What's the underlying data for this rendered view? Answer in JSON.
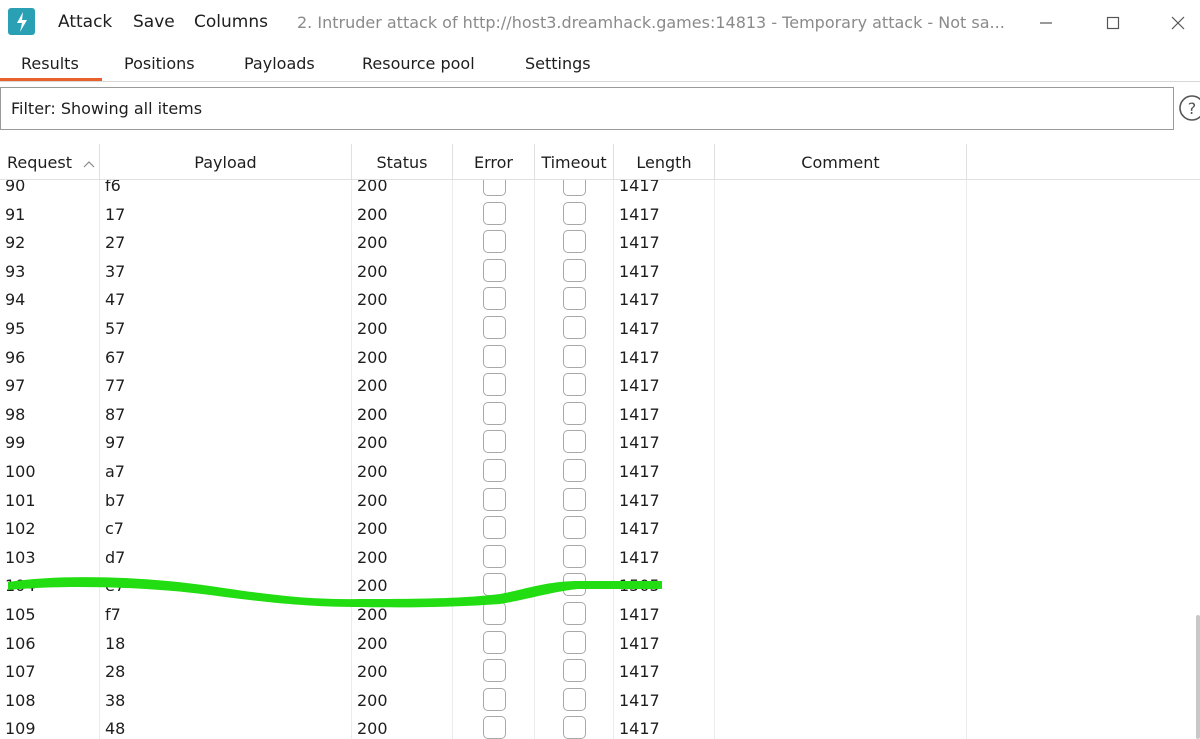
{
  "window": {
    "title": "2. Intruder attack of http://host3.dreamhack.games:14813 - Temporary attack - Not sa..."
  },
  "menu": {
    "attack": "Attack",
    "save": "Save",
    "columns": "Columns"
  },
  "tabs": {
    "results": "Results",
    "positions": "Positions",
    "payloads": "Payloads",
    "resource_pool": "Resource pool",
    "settings": "Settings"
  },
  "filter": {
    "text": "Filter: Showing all items"
  },
  "columns": {
    "request": "Request",
    "payload": "Payload",
    "status": "Status",
    "error": "Error",
    "timeout": "Timeout",
    "length": "Length",
    "comment": "Comment"
  },
  "rows": [
    {
      "request": "90",
      "payload": "f6",
      "status": "200",
      "length": "1417"
    },
    {
      "request": "91",
      "payload": "17",
      "status": "200",
      "length": "1417"
    },
    {
      "request": "92",
      "payload": "27",
      "status": "200",
      "length": "1417"
    },
    {
      "request": "93",
      "payload": "37",
      "status": "200",
      "length": "1417"
    },
    {
      "request": "94",
      "payload": "47",
      "status": "200",
      "length": "1417"
    },
    {
      "request": "95",
      "payload": "57",
      "status": "200",
      "length": "1417"
    },
    {
      "request": "96",
      "payload": "67",
      "status": "200",
      "length": "1417"
    },
    {
      "request": "97",
      "payload": "77",
      "status": "200",
      "length": "1417"
    },
    {
      "request": "98",
      "payload": "87",
      "status": "200",
      "length": "1417"
    },
    {
      "request": "99",
      "payload": "97",
      "status": "200",
      "length": "1417"
    },
    {
      "request": "100",
      "payload": "a7",
      "status": "200",
      "length": "1417"
    },
    {
      "request": "101",
      "payload": "b7",
      "status": "200",
      "length": "1417"
    },
    {
      "request": "102",
      "payload": "c7",
      "status": "200",
      "length": "1417"
    },
    {
      "request": "103",
      "payload": "d7",
      "status": "200",
      "length": "1417"
    },
    {
      "request": "104",
      "payload": "e7",
      "status": "200",
      "length": "1505"
    },
    {
      "request": "105",
      "payload": "f7",
      "status": "200",
      "length": "1417"
    },
    {
      "request": "106",
      "payload": "18",
      "status": "200",
      "length": "1417"
    },
    {
      "request": "107",
      "payload": "28",
      "status": "200",
      "length": "1417"
    },
    {
      "request": "108",
      "payload": "38",
      "status": "200",
      "length": "1417"
    },
    {
      "request": "109",
      "payload": "48",
      "status": "200",
      "length": "1417"
    }
  ],
  "colors": {
    "accent": "#e8612c",
    "app_icon": "#2aa0b4",
    "highlight": "#22dd11"
  }
}
